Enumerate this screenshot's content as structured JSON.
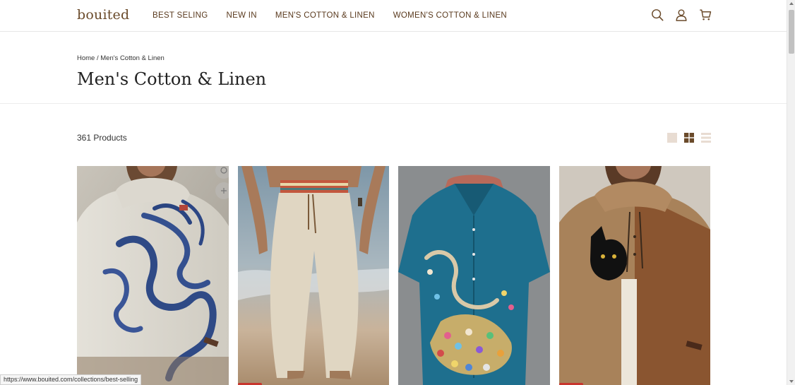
{
  "brand": {
    "logo": "bouited",
    "color": "#6a4a2a"
  },
  "nav": {
    "items": [
      {
        "label": "BEST SELING"
      },
      {
        "label": "NEW IN"
      },
      {
        "label": "MEN'S COTTON & LINEN"
      },
      {
        "label": "WOMEN'S COTTON & LINEN"
      }
    ]
  },
  "header_icons": {
    "search": "search-icon",
    "account": "user-icon",
    "cart": "cart-icon"
  },
  "breadcrumb": {
    "home": "Home",
    "separator": "/",
    "current": "Men's Cotton & Linen"
  },
  "page": {
    "title": "Men's Cotton & Linen",
    "product_count": "361 Products"
  },
  "view_options": {
    "active": "grid-4",
    "options": [
      "grid-2",
      "grid-4",
      "list"
    ]
  },
  "products": [
    {
      "name": "octopus-print-linen-hoodie-shirt",
      "sale_badge": true
    },
    {
      "name": "linen-beach-pants",
      "sale_badge": true
    },
    {
      "name": "gem-octopus-print-shirt",
      "sale_badge": false
    },
    {
      "name": "cat-colorblock-linen-hoodie",
      "sale_badge": true
    }
  ],
  "status_bar": {
    "url": "https://www.bouited.com/collections/best-selling"
  },
  "colors": {
    "accent": "#6a4a2a",
    "sale": "#c8362e",
    "text": "#222222"
  }
}
